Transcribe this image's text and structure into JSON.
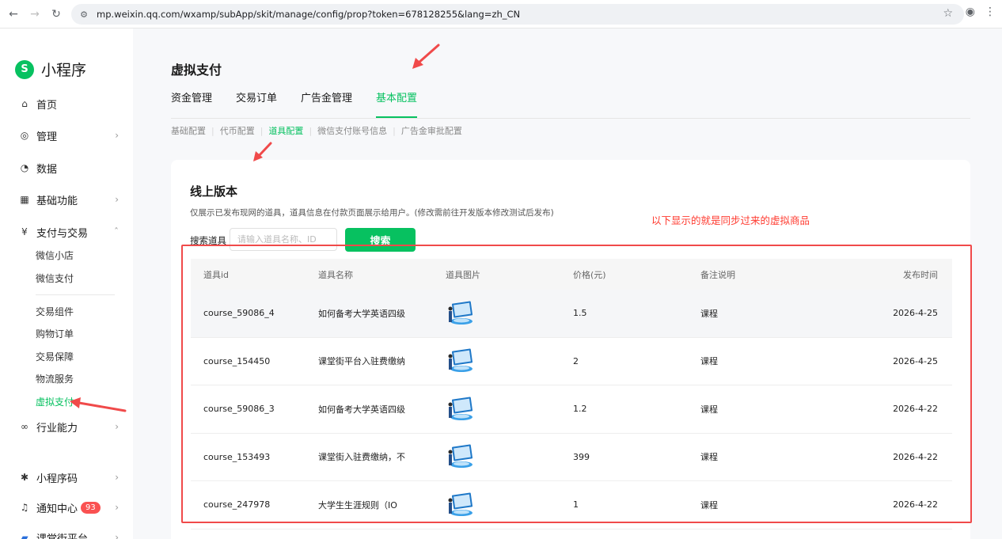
{
  "browser": {
    "url": "mp.weixin.qq.com/wxamp/subApp/skit/manage/config/prop?token=678128255&lang=zh_CN"
  },
  "sidebar": {
    "logo_text": "小程序",
    "items": [
      {
        "label": "首页",
        "icon": "home-icon"
      },
      {
        "label": "管理",
        "icon": "manage-icon"
      },
      {
        "label": "数据",
        "icon": "data-icon"
      },
      {
        "label": "基础功能",
        "icon": "grid-icon"
      },
      {
        "label": "支付与交易",
        "icon": "yen-icon"
      }
    ],
    "pay_sub": [
      "微信小店",
      "微信支付"
    ],
    "trade_sub": [
      "交易组件",
      "购物订单",
      "交易保障",
      "物流服务",
      "虚拟支付"
    ],
    "industry": "行业能力",
    "qrcode": "小程序码",
    "notify": "通知中心",
    "notify_count": "93",
    "platform": "课堂街平台"
  },
  "main": {
    "title": "虚拟支付",
    "tabs": [
      "资金管理",
      "交易订单",
      "广告金管理",
      "基本配置"
    ],
    "subtabs": [
      "基础配置",
      "代币配置",
      "道具配置",
      "微信支付账号信息",
      "广告金审批配置"
    ]
  },
  "card": {
    "title": "线上版本",
    "desc": "仅展示已发布现网的道具，道具信息在付款页面展示给用户。(修改需前往开发版本修改测试后发布)",
    "search_label": "搜索道具",
    "search_placeholder": "请输入道具名称、ID",
    "search_button": "搜索"
  },
  "annotation": "以下显示的就是同步过来的虚拟商品",
  "table": {
    "headers": [
      "道具id",
      "道具名称",
      "道具图片",
      "价格(元)",
      "备注说明",
      "发布时间"
    ],
    "rows": [
      {
        "id": "course_59086_4",
        "name": "如何备考大学英语四级",
        "price": "1.5",
        "note": "课程",
        "date": "2026-4-25"
      },
      {
        "id": "course_154450",
        "name": "课堂街平台入驻费缴纳",
        "price": "2",
        "note": "课程",
        "date": "2026-4-25"
      },
      {
        "id": "course_59086_3",
        "name": "如何备考大学英语四级",
        "price": "1.2",
        "note": "课程",
        "date": "2026-4-22"
      },
      {
        "id": "course_153493",
        "name": "课堂街入驻费缴纳，不",
        "price": "399",
        "note": "课程",
        "date": "2026-4-22"
      },
      {
        "id": "course_247978",
        "name": "大学生生涯规则（IO",
        "price": "1",
        "note": "课程",
        "date": "2026-4-22"
      }
    ]
  },
  "colors": {
    "brand": "#07c160",
    "annotation": "#ff3b30",
    "badge": "#fa5151"
  }
}
